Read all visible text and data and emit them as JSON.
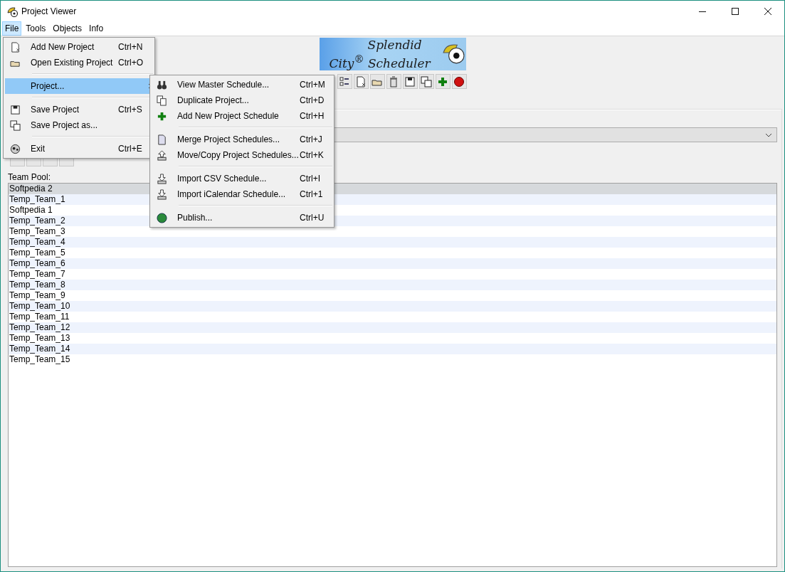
{
  "window": {
    "title": "Project Viewer"
  },
  "menu_bar": [
    {
      "label": "File",
      "selected": true
    },
    {
      "label": "Tools",
      "selected": false
    },
    {
      "label": "Objects",
      "selected": false
    },
    {
      "label": "Info",
      "selected": false
    }
  ],
  "logo": {
    "line1": "Splendid",
    "line2": "City$^{®}$ Scheduler"
  },
  "team_pool": {
    "label": "Team Pool:",
    "teams": [
      {
        "name": "Softpedia 2",
        "selected": true
      },
      {
        "name": "Temp_Team_1",
        "selected": false
      },
      {
        "name": "Softpedia 1",
        "selected": false
      },
      {
        "name": "Temp_Team_2",
        "selected": false
      },
      {
        "name": "Temp_Team_3",
        "selected": false
      },
      {
        "name": "Temp_Team_4",
        "selected": false
      },
      {
        "name": "Temp_Team_5",
        "selected": false
      },
      {
        "name": "Temp_Team_6",
        "selected": false
      },
      {
        "name": "Temp_Team_7",
        "selected": false
      },
      {
        "name": "Temp_Team_8",
        "selected": false
      },
      {
        "name": "Temp_Team_9",
        "selected": false
      },
      {
        "name": "Temp_Team_10",
        "selected": false
      },
      {
        "name": "Temp_Team_11",
        "selected": false
      },
      {
        "name": "Temp_Team_12",
        "selected": false
      },
      {
        "name": "Temp_Team_13",
        "selected": false
      },
      {
        "name": "Temp_Team_14",
        "selected": false
      },
      {
        "name": "Temp_Team_15",
        "selected": false
      }
    ]
  },
  "file_menu": {
    "items": [
      {
        "kind": "item",
        "label": "Add New Project",
        "shortcut": "Ctrl+N",
        "selected": false
      },
      {
        "kind": "item",
        "label": "Open Existing Project",
        "shortcut": "Ctrl+O",
        "selected": false
      },
      {
        "kind": "separator"
      },
      {
        "kind": "submenu",
        "label": "Project...",
        "selected": true
      },
      {
        "kind": "separator"
      },
      {
        "kind": "item",
        "label": "Save Project",
        "shortcut": "Ctrl+S",
        "selected": false
      },
      {
        "kind": "item",
        "label": "Save Project as...",
        "selected": false
      },
      {
        "kind": "separator"
      },
      {
        "kind": "item",
        "label": "Exit",
        "shortcut": "Ctrl+E",
        "selected": false
      }
    ]
  },
  "project_submenu": {
    "items": [
      {
        "kind": "item",
        "label": "View Master Schedule...",
        "shortcut": "Ctrl+M",
        "selected": false
      },
      {
        "kind": "item",
        "label": "Duplicate Project...",
        "shortcut": "Ctrl+D",
        "selected": false
      },
      {
        "kind": "item",
        "label": "Add New Project Schedule",
        "shortcut": "Ctrl+H",
        "selected": false
      },
      {
        "kind": "separator"
      },
      {
        "kind": "item",
        "label": "Merge Project Schedules...",
        "shortcut": "Ctrl+J",
        "selected": false
      },
      {
        "kind": "item",
        "label": "Move/Copy Project Schedules...",
        "shortcut": "Ctrl+K",
        "selected": false
      },
      {
        "kind": "separator"
      },
      {
        "kind": "item",
        "label": "Import CSV Schedule...",
        "shortcut": "Ctrl+I",
        "selected": false
      },
      {
        "kind": "item",
        "label": "Import iCalendar Schedule...",
        "shortcut": "Ctrl+1",
        "selected": false
      },
      {
        "kind": "separator"
      },
      {
        "kind": "item",
        "label": "Publish...",
        "shortcut": "Ctrl+U",
        "selected": false
      }
    ]
  }
}
